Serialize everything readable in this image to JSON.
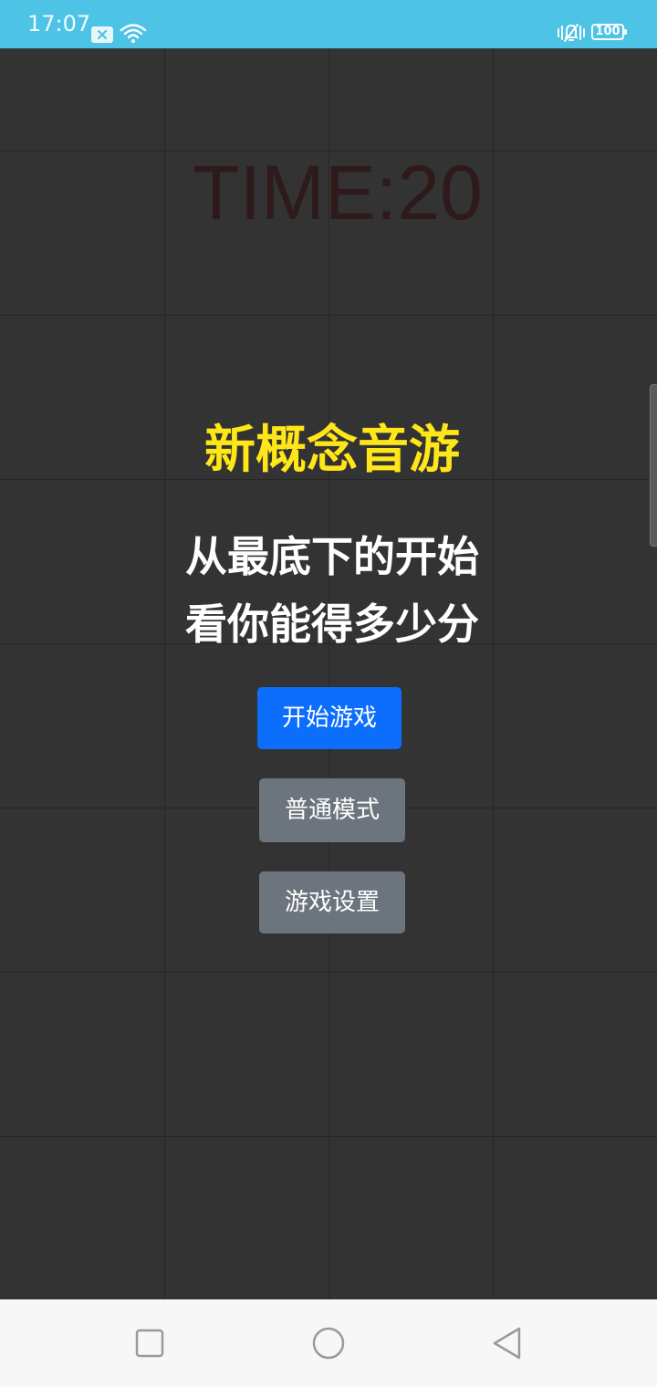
{
  "status_bar": {
    "time": "17:07",
    "battery": "100",
    "icons": [
      "message-icon",
      "wifi-icon",
      "vibrate-icon",
      "battery-icon"
    ]
  },
  "game": {
    "timer": "TIME:20",
    "title": "新概念音游",
    "subtitle_line1": "从最底下的开始",
    "subtitle_line2": "看你能得多少分",
    "buttons": {
      "start": "开始游戏",
      "mode": "普通模式",
      "settings": "游戏设置"
    }
  },
  "colors": {
    "status_bar": "#4dc3e5",
    "background": "#333333",
    "title": "#ffe619",
    "primary_button": "#0d6efd",
    "secondary_button": "#6c757d",
    "timer": "#2e1a1a"
  },
  "nav_bar": {
    "icons": [
      "recent-apps-icon",
      "home-icon",
      "back-icon"
    ]
  }
}
